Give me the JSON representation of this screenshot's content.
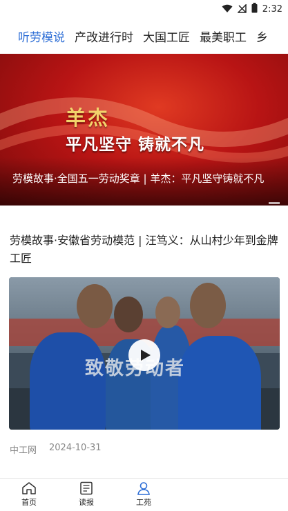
{
  "status_bar": {
    "time": "2:32",
    "icons": [
      "wifi-icon",
      "signal-icon",
      "battery-icon"
    ]
  },
  "tabs": [
    {
      "label": "听劳模说",
      "active": true
    },
    {
      "label": "产改进行时",
      "active": false
    },
    {
      "label": "大国工匠",
      "active": false
    },
    {
      "label": "最美职工",
      "active": false
    },
    {
      "label": "乡",
      "active": false
    }
  ],
  "hero": {
    "name": "羊杰",
    "slogan": "平凡坚守  铸就不凡",
    "caption": "劳模故事·全国五一劳动奖章 | 羊杰：平凡坚守铸就不凡"
  },
  "article": {
    "title": "劳模故事·安徽省劳动模范 | 汪笃义：从山村少年到金牌工匠",
    "video_watermark": "致敬劳动者",
    "source": "中工网",
    "date": "2024-10-31"
  },
  "bottom_nav": {
    "items": [
      {
        "label": "首页",
        "icon": "home-icon"
      },
      {
        "label": "读报",
        "icon": "newspaper-icon"
      },
      {
        "label": "工苑",
        "icon": "person-icon",
        "active": true
      }
    ]
  },
  "colors": {
    "accent": "#2f6fd6",
    "hero_red": "#b81414",
    "hero_gold": "#f2d36b",
    "meta_gray": "#888888"
  }
}
